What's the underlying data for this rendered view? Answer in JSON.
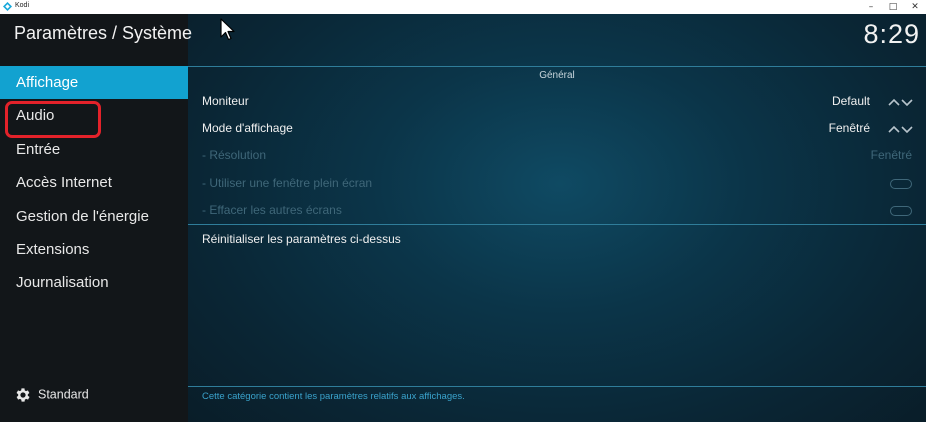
{
  "window": {
    "title": "Kodi",
    "minimize_glyph": "–",
    "maximize_glyph": "□",
    "close_glyph": "✕"
  },
  "header": {
    "page_title": "Paramètres / Système",
    "clock": "8:29"
  },
  "sidebar": {
    "items": [
      {
        "label": "Affichage",
        "active": true
      },
      {
        "label": "Audio",
        "highlighted": true
      },
      {
        "label": "Entrée"
      },
      {
        "label": "Accès Internet"
      },
      {
        "label": "Gestion de l'énergie"
      },
      {
        "label": "Extensions"
      },
      {
        "label": "Journalisation"
      }
    ],
    "settings_level": "Standard"
  },
  "main": {
    "section": "Général",
    "settings": [
      {
        "label": "Moniteur",
        "value": "Default",
        "control": "spinner",
        "enabled": true
      },
      {
        "label": "Mode d'affichage",
        "value": "Fenêtré",
        "control": "spinner",
        "enabled": true
      },
      {
        "label": "- Résolution",
        "value": "Fenêtré",
        "control": "none",
        "enabled": false
      },
      {
        "label": "- Utiliser une fenêtre plein écran",
        "value": "",
        "control": "toggle",
        "enabled": false
      },
      {
        "label": "- Effacer les autres écrans",
        "value": "",
        "control": "toggle",
        "enabled": false
      }
    ],
    "reset_label": "Réinitialiser les paramètres ci-dessus",
    "description": "Cette catégorie contient les paramètres relatifs aux affichages."
  },
  "colors": {
    "accent": "#12a2d0",
    "annotation_red": "#e3222a",
    "disabled_text": "#3f6779"
  }
}
